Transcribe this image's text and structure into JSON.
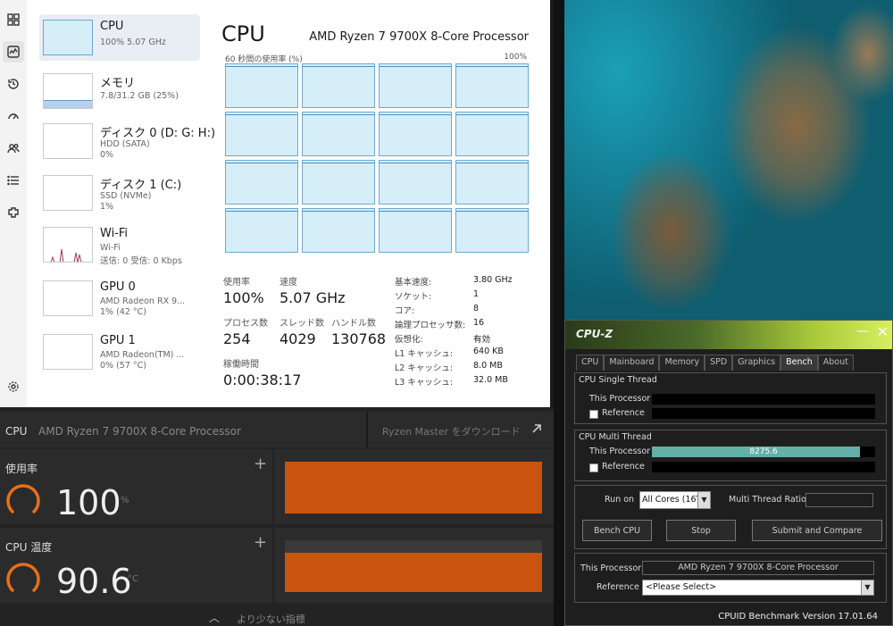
{
  "task_manager": {
    "title": "CPU",
    "model": "AMD Ryzen 7 9700X 8-Core Processor",
    "axis_left": "60 秒間の使用率 (%)",
    "axis_right": "100%",
    "sidebar_icons": [
      "processes-icon",
      "performance-icon",
      "history-icon",
      "startup-icon",
      "users-icon",
      "details-icon",
      "services-icon",
      "settings-icon"
    ],
    "devices": [
      {
        "name": "CPU",
        "line1": "100%  5.07 GHz",
        "line2": ""
      },
      {
        "name": "メモリ",
        "line1": "7.8/31.2 GB (25%)",
        "line2": ""
      },
      {
        "name": "ディスク 0 (D: G: H:)",
        "line1": "HDD (SATA)",
        "line2": "0%"
      },
      {
        "name": "ディスク 1 (C:)",
        "line1": "SSD (NVMe)",
        "line2": "1%"
      },
      {
        "name": "Wi-Fi",
        "line1": "Wi-Fi",
        "line2": "送信: 0  受信: 0 Kbps"
      },
      {
        "name": "GPU 0",
        "line1": "AMD Radeon RX 9...",
        "line2": "1%  (42 °C)"
      },
      {
        "name": "GPU 1",
        "line1": "AMD Radeon(TM) ...",
        "line2": "0%  (57 °C)"
      }
    ],
    "stats": {
      "usage_label": "使用率",
      "usage": "100%",
      "speed_label": "速度",
      "speed": "5.07 GHz",
      "processes_label": "プロセス数",
      "processes": "254",
      "threads_label": "スレッド数",
      "threads": "4029",
      "handles_label": "ハンドル数",
      "handles": "130768",
      "uptime_label": "稼働時間",
      "uptime": "0:00:38:17"
    },
    "specs": [
      {
        "k": "基本速度:",
        "v": "3.80 GHz"
      },
      {
        "k": "ソケット:",
        "v": "1"
      },
      {
        "k": "コア:",
        "v": "8"
      },
      {
        "k": "論理プロセッサ数:",
        "v": "16"
      },
      {
        "k": "仮想化:",
        "v": "有効"
      },
      {
        "k": "L1 キャッシュ:",
        "v": "640 KB"
      },
      {
        "k": "L2 キャッシュ:",
        "v": "8.0 MB"
      },
      {
        "k": "L3 キャッシュ:",
        "v": "32.0 MB"
      }
    ]
  },
  "ryzen_master": {
    "cpu_label": "CPU",
    "cpu_name": "AMD Ryzen 7 9700X 8-Core Processor",
    "download_label": "Ryzen Master をダウンロード",
    "usage": {
      "label": "使用率",
      "value": "100",
      "unit": "%",
      "fraction": 1.0
    },
    "temp": {
      "label": "CPU 温度",
      "value": "90.6",
      "unit": "°C",
      "fraction": 1.0
    },
    "less_label": "より少ない指標",
    "accent": "#c8540f"
  },
  "cpuz": {
    "title": "CPU-Z",
    "tabs": [
      "CPU",
      "Mainboard",
      "Memory",
      "SPD",
      "Graphics",
      "Bench",
      "About"
    ],
    "active_tab": "Bench",
    "single_thread_title": "CPU Single Thread",
    "multi_thread_title": "CPU Multi Thread",
    "this_processor_label": "This Processor",
    "reference_label": "Reference",
    "multi_score": "8275.6",
    "multi_fraction": 0.93,
    "run_on_label": "Run on",
    "run_on_value": "All Cores (16T",
    "ratio_label": "Multi Thread Ratio",
    "bench_btn": "Bench CPU",
    "stop_btn": "Stop",
    "submit_btn": "Submit and Compare",
    "processor_value": "AMD Ryzen 7 9700X 8-Core Processor",
    "reference_select": "<Please Select>",
    "version": "CPUID Benchmark Version 17.01.64",
    "bar_color": "#62b0a8"
  }
}
